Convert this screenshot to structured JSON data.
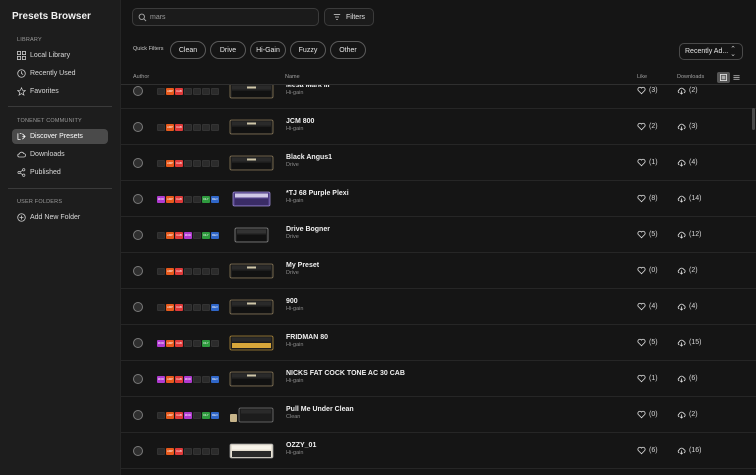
{
  "sidebar": {
    "title": "Presets Browser",
    "sections": [
      {
        "title": "LIBRARY",
        "items": [
          {
            "label": "Local Library",
            "icon": "grid-icon"
          },
          {
            "label": "Recently Used",
            "icon": "clock-icon"
          },
          {
            "label": "Favorites",
            "icon": "star-icon"
          }
        ]
      },
      {
        "title": "TONENET COMMUNITY",
        "items": [
          {
            "label": "Discover Presets",
            "icon": "discover-icon",
            "active": true
          },
          {
            "label": "Downloads",
            "icon": "cloud-icon"
          },
          {
            "label": "Published",
            "icon": "share-icon"
          }
        ]
      },
      {
        "title": "USER FOLDERS",
        "items": [
          {
            "label": "Add New Folder",
            "icon": "plus-circle-icon"
          }
        ]
      }
    ]
  },
  "search": {
    "value": "mars",
    "placeholder": "Search"
  },
  "filters_label": "Filters",
  "quick_filters": {
    "label": "Quick Filters",
    "chips": [
      "Clean",
      "Drive",
      "Hi-Gain",
      "Fuzzy",
      "Other"
    ]
  },
  "sort": {
    "label": "Recently Ad..."
  },
  "columns": {
    "author": "Author",
    "name": "Name",
    "like": "Like",
    "downloads": "Downloads"
  },
  "colors": {
    "amp": "#e85a1c",
    "cab": "#e03a3a",
    "mod": "#b03ad0",
    "dly": "#2e9a3e",
    "rev": "#2f66c8",
    "accent": "#4a4a4a"
  },
  "rows": [
    {
      "name": "Mesa Mark III",
      "genre": "Hi-gain",
      "likes": "(3)",
      "downloads": "(2)",
      "chain": [
        "",
        "AMP",
        "CAB",
        "",
        "",
        "",
        ""
      ],
      "amp": "black"
    },
    {
      "name": "JCM 800",
      "genre": "Hi-gain",
      "likes": "(2)",
      "downloads": "(3)",
      "chain": [
        "",
        "AMP",
        "CAB",
        "",
        "",
        "",
        ""
      ],
      "amp": "black"
    },
    {
      "name": "Black Angus1",
      "genre": "Drive",
      "likes": "(1)",
      "downloads": "(4)",
      "chain": [
        "",
        "AMP",
        "CAB",
        "",
        "",
        "",
        ""
      ],
      "amp": "black"
    },
    {
      "name": "*TJ 68 Purple Plexi",
      "genre": "Hi-gain",
      "likes": "(8)",
      "downloads": "(14)",
      "chain": [
        "MOD",
        "AMP",
        "CAB",
        "",
        "",
        "DLY",
        "REV"
      ],
      "amp": "purple"
    },
    {
      "name": "Drive Bogner",
      "genre": "Drive",
      "likes": "(5)",
      "downloads": "(12)",
      "chain": [
        "",
        "AMP",
        "CAB",
        "MOD",
        "",
        "DLY",
        "REV"
      ],
      "amp": "black-small"
    },
    {
      "name": "My Preset",
      "genre": "Drive",
      "likes": "(0)",
      "downloads": "(2)",
      "chain": [
        "",
        "AMP",
        "CAB",
        "",
        "",
        "",
        ""
      ],
      "amp": "black"
    },
    {
      "name": "900",
      "genre": "Hi-gain",
      "likes": "(4)",
      "downloads": "(4)",
      "chain": [
        "",
        "AMP",
        "CAB",
        "",
        "",
        "",
        "REV"
      ],
      "amp": "black"
    },
    {
      "name": "FRIDMAN 80",
      "genre": "Hi-gain",
      "likes": "(5)",
      "downloads": "(15)",
      "chain": [
        "MOD",
        "AMP",
        "CAB",
        "",
        "",
        "DLY",
        ""
      ],
      "amp": "gold"
    },
    {
      "name": "NICKS FAT COCK TONE AC 30 CAB",
      "genre": "Hi-gain",
      "likes": "(1)",
      "downloads": "(6)",
      "chain": [
        "MOD",
        "AMP",
        "CAB",
        "MOD",
        "",
        "",
        "REV"
      ],
      "amp": "black"
    },
    {
      "name": "Pull Me Under Clean",
      "genre": "Clean",
      "likes": "(0)",
      "downloads": "(2)",
      "chain": [
        "",
        "AMP",
        "CAB",
        "MOD",
        "",
        "DLY",
        "REV"
      ],
      "amp": "black-pedal"
    },
    {
      "name": "OZZY_01",
      "genre": "Hi-gain",
      "likes": "(6)",
      "downloads": "(16)",
      "chain": [
        "",
        "AMP",
        "CAB",
        "",
        "",
        "",
        ""
      ],
      "amp": "white"
    }
  ]
}
